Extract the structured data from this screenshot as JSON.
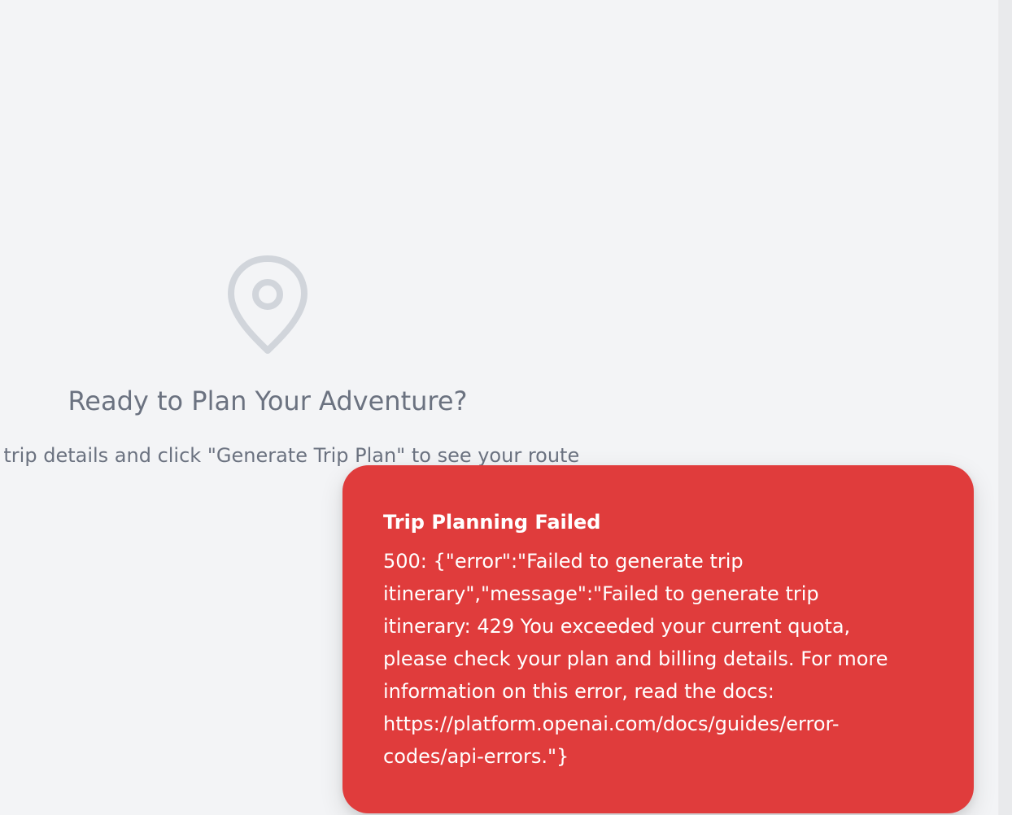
{
  "empty_state": {
    "icon": "map-pin-icon",
    "title": "Ready to Plan Your Adventure?",
    "subtitle": "e trip details and click \"Generate Trip Plan\" to see your route"
  },
  "toast": {
    "title": "Trip Planning Failed",
    "message": "500: {\"error\":\"Failed to generate trip itinerary\",\"message\":\"Failed to generate trip itinerary: 429 You exceeded your current quota, please check your plan and billing details. For more information on this error, read the docs: https://platform.openai.com/docs/guides/error-codes/api-errors.\"}"
  },
  "colors": {
    "background": "#f3f4f6",
    "muted_text": "#6b7280",
    "icon_gray": "#d1d5db",
    "error_red": "#e03c3c"
  }
}
